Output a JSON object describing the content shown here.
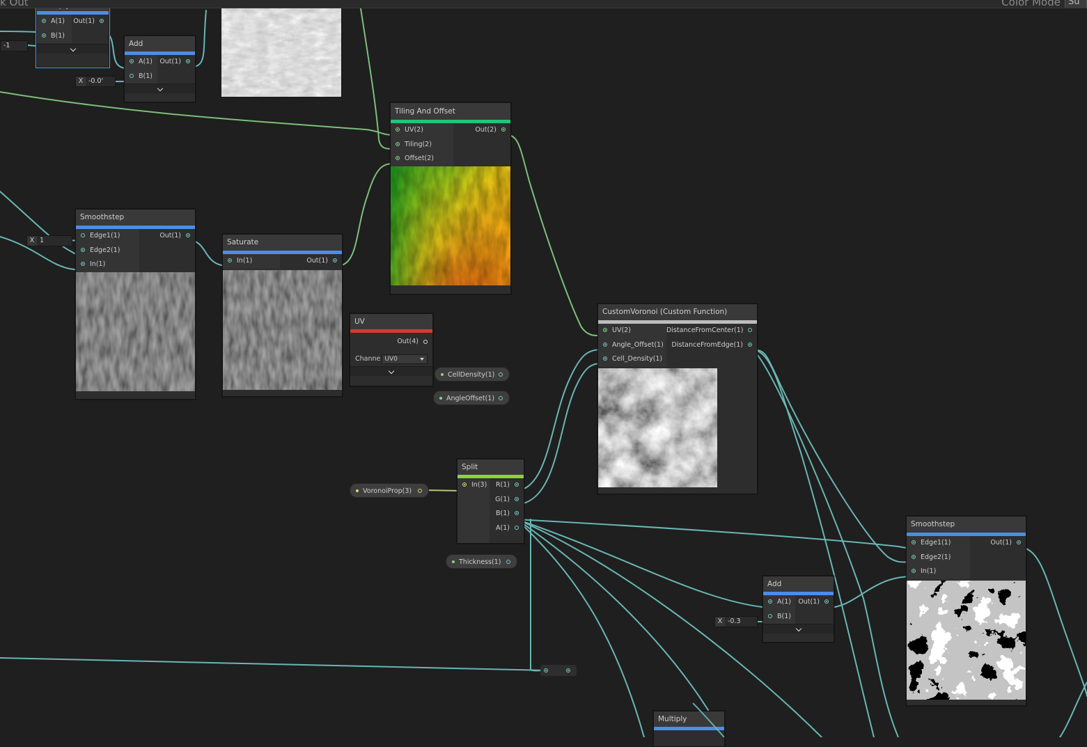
{
  "topbar": {
    "left_text": "k Out",
    "right_text": "Color Mode",
    "right_box": "Su"
  },
  "nodes": {
    "multiply_top": {
      "title": "Multiply",
      "in": [
        "A(1)",
        "B(1)"
      ],
      "out": [
        "Out(1)"
      ],
      "bar_color": "#4c8ee6"
    },
    "add_top": {
      "title": "Add",
      "in": [
        "A(1)",
        "B(1)"
      ],
      "out": [
        "Out(1)"
      ],
      "bar_color": "#4c8ee6"
    },
    "tiling": {
      "title": "Tiling And Offset",
      "in": [
        "UV(2)",
        "Tiling(2)",
        "Offset(2)"
      ],
      "out": [
        "Out(2)"
      ],
      "bar_color": "#22c47a"
    },
    "smoothstep_left": {
      "title": "Smoothstep",
      "in": [
        "Edge1(1)",
        "Edge2(1)",
        "In(1)"
      ],
      "out": [
        "Out(1)"
      ],
      "bar_color": "#4c8ee6"
    },
    "saturate": {
      "title": "Saturate",
      "in": [
        "In(1)"
      ],
      "out": [
        "Out(1)"
      ],
      "bar_color": "#4c8ee6"
    },
    "uv": {
      "title": "UV",
      "out": [
        "Out(4)"
      ],
      "channel_label": "Channe",
      "channel_value": "UV0",
      "bar_color": "#d63a2e"
    },
    "voronoi": {
      "title": "CustomVoronoi (Custom Function)",
      "in": [
        "UV(2)",
        "Angle_Offset(1)",
        "Cell_Density(1)"
      ],
      "out": [
        "DistanceFromCenter(1)",
        "DistanceFromEdge(1)"
      ],
      "bar_color": "#bdbdbd"
    },
    "split": {
      "title": "Split",
      "in": [
        "In(3)"
      ],
      "out": [
        "R(1)",
        "G(1)",
        "B(1)",
        "A(1)"
      ],
      "bar_color": "#8fd13a"
    },
    "smoothstep_right": {
      "title": "Smoothstep",
      "in": [
        "Edge1(1)",
        "Edge2(1)",
        "In(1)"
      ],
      "out": [
        "Out(1)"
      ],
      "bar_color": "#4c8ee6"
    },
    "add_right": {
      "title": "Add",
      "in": [
        "A(1)",
        "B(1)"
      ],
      "out": [
        "Out(1)"
      ],
      "bar_color": "#4c8ee6"
    },
    "multiply_bottom": {
      "title": "Multiply",
      "bar_color": "#4c8ee6"
    }
  },
  "default_values": {
    "multiply_b": "-1",
    "add_top_b": "-0.0'",
    "smoothstep_edge1": "1",
    "add_right_b": "-0.3",
    "x_label": "X"
  },
  "properties": {
    "cell_density": "CellDensity(1)",
    "angle_offset": "AngleOffset(1)",
    "voronoi_prop": "VoronoiProp(3)",
    "thickness": "Thickness(1)"
  }
}
